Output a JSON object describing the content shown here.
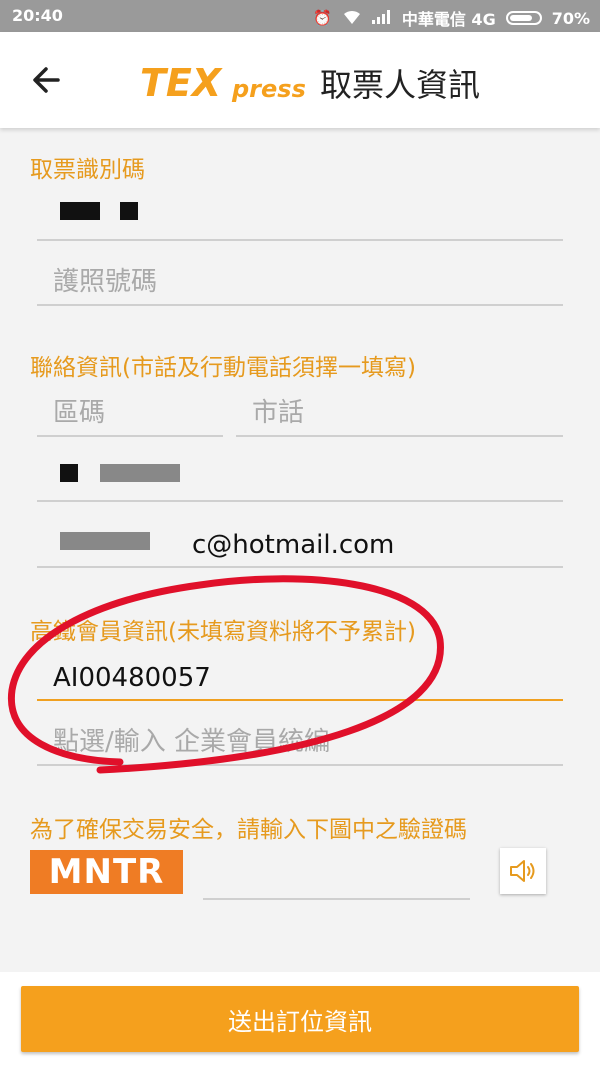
{
  "status_bar": {
    "time": "20:40",
    "carrier": "中華電信 4G",
    "battery": "70%"
  },
  "app_bar": {
    "logo_text_main": "TEX",
    "logo_text_sub": "press",
    "title": "取票人資訊"
  },
  "sections": {
    "ticket_id": {
      "label": "取票識別碼",
      "id_value": "",
      "passport_placeholder": "護照號碼"
    },
    "contact": {
      "label": "聯絡資訊(市話及行動電話須擇一填寫)",
      "area_code_placeholder": "區碼",
      "landline_placeholder": "市話",
      "mobile_value": "",
      "email_value": "c@hotmail.com"
    },
    "membership": {
      "label": "高鐵會員資訊(未填寫資料將不予累計)",
      "member_id_value": "AI00480057",
      "corporate_placeholder": "點選/輸入 企業會員統編"
    },
    "captcha": {
      "label": "為了確保交易安全，請輸入下圖中之驗證碼",
      "code_image_text": "MNTR",
      "input_value": ""
    }
  },
  "submit_label": "送出訂位資訊",
  "colors": {
    "accent": "#f5a01d",
    "label": "#e69a1e",
    "annotation": "#e0102a"
  }
}
